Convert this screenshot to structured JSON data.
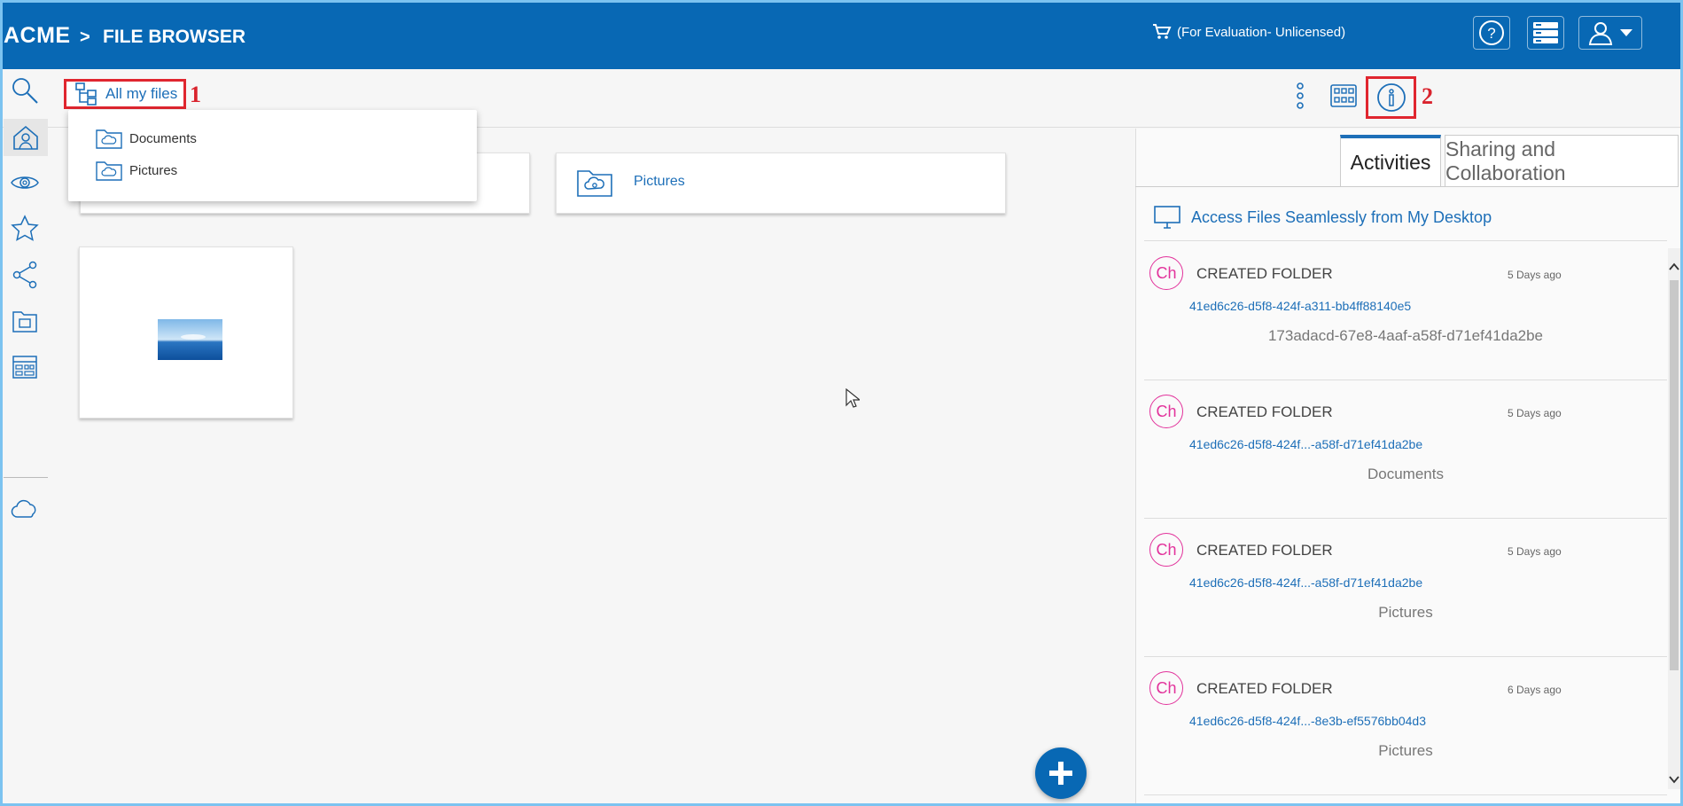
{
  "header": {
    "brand": "ACME",
    "separator": ">",
    "page": "FILE BROWSER",
    "license": "(For Evaluation- Unlicensed)"
  },
  "toolbar": {
    "all_files_label": "All my files",
    "annotation_1": "1",
    "annotation_2": "2"
  },
  "dropdown": {
    "items": [
      {
        "label": "Documents",
        "icon": "cloud-folder-icon"
      },
      {
        "label": "Pictures",
        "icon": "cloud-folder-icon"
      }
    ]
  },
  "folders": [
    {
      "label": "Pictures"
    }
  ],
  "tabs": [
    {
      "label": "Activities",
      "active": true
    },
    {
      "label": "Sharing and Collaboration",
      "active": false
    }
  ],
  "panel": {
    "desktop_link": "Access Files Seamlessly from My Desktop",
    "activities": [
      {
        "avatar": "Ch",
        "title": "CREATED FOLDER",
        "time": "5 Days ago",
        "id": "41ed6c26-d5f8-424f-a311-bb4ff88140e5",
        "name": "173adacd-67e8-4aaf-a58f-d71ef41da2be"
      },
      {
        "avatar": "Ch",
        "title": "CREATED FOLDER",
        "time": "5 Days ago",
        "id": "41ed6c26-d5f8-424f...-a58f-d71ef41da2be",
        "name": "Documents"
      },
      {
        "avatar": "Ch",
        "title": "CREATED FOLDER",
        "time": "5 Days ago",
        "id": "41ed6c26-d5f8-424f...-a58f-d71ef41da2be",
        "name": "Pictures"
      },
      {
        "avatar": "Ch",
        "title": "CREATED FOLDER",
        "time": "6 Days ago",
        "id": "41ed6c26-d5f8-424f...-8e3b-ef5576bb04d3",
        "name": "Pictures"
      }
    ]
  },
  "colors": {
    "header_bg": "#0868b4",
    "accent": "#1d6fb8",
    "highlight_red": "#e0262f",
    "avatar_pink": "#e2329b"
  }
}
